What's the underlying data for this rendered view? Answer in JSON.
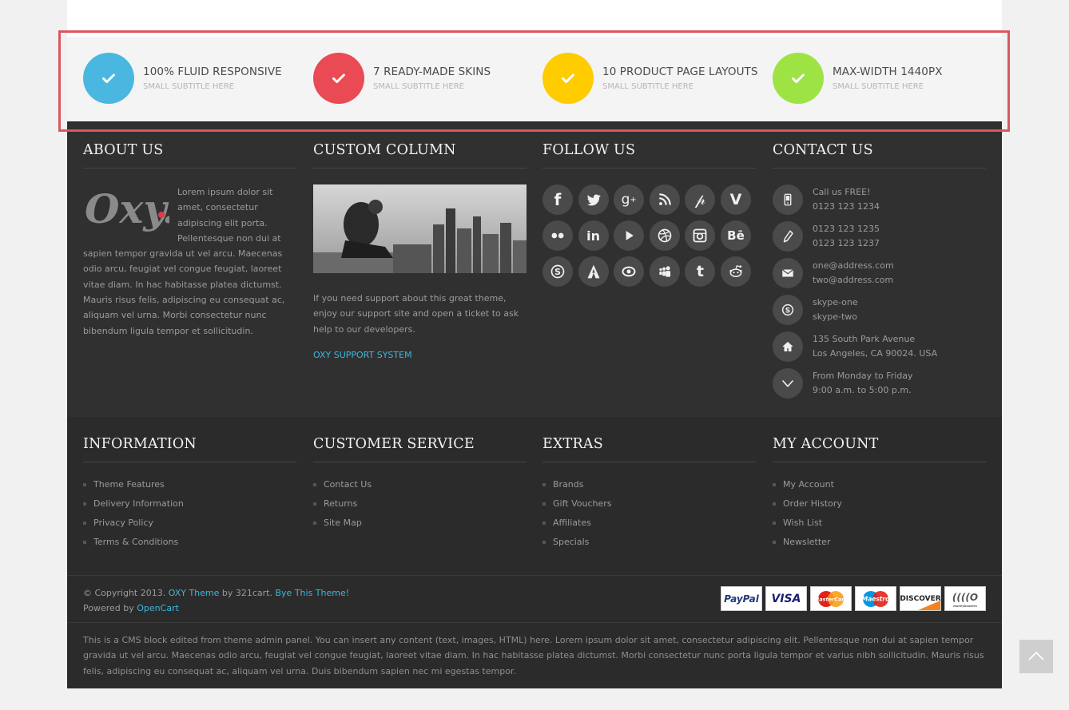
{
  "features": [
    {
      "title": "100% FLUID RESPONSIVE",
      "subtitle": "SMALL SUBTITLE HERE",
      "color": "#4ab7e0"
    },
    {
      "title": "7 READY-MADE SKINS",
      "subtitle": "SMALL SUBTITLE HERE",
      "color": "#ea4a54"
    },
    {
      "title": "10 PRODUCT PAGE LAYOUTS",
      "subtitle": "SMALL SUBTITLE HERE",
      "color": "#ffcc00"
    },
    {
      "title": "MAX-WIDTH 1440PX",
      "subtitle": "SMALL SUBTITLE HERE",
      "color": "#9ee344"
    }
  ],
  "about": {
    "heading": "ABOUT US",
    "logo_text": "Oxy.",
    "text": "Lorem ipsum dolor sit amet, consectetur adipiscing elit porta. Pellentesque non dui at sapien tempor gravida ut vel arcu. Maecenas odio arcu, feugiat vel congue feugiat, laoreet vitae diam. In hac habitasse platea dictumst. Mauris risus felis, adipiscing eu consequat ac, aliquam vel urna. Morbi consectetur nunc bibendum ligula tempor et sollicitudin."
  },
  "custom": {
    "heading": "CUSTOM COLUMN",
    "text": "If you need support about this great theme, enjoy our support site and open a ticket to ask help to our developers.",
    "link": "OXY SUPPORT SYSTEM"
  },
  "follow": {
    "heading": "FOLLOW US",
    "icons": [
      {
        "name": "facebook-icon",
        "glyph": "f"
      },
      {
        "name": "twitter-icon",
        "glyph": "🐦"
      },
      {
        "name": "google-plus-icon",
        "glyph": "g+"
      },
      {
        "name": "rss-icon",
        "glyph": "rss"
      },
      {
        "name": "pinterest-icon",
        "glyph": "P"
      },
      {
        "name": "vimeo-icon",
        "glyph": "V"
      },
      {
        "name": "flickr-icon",
        "glyph": "●●"
      },
      {
        "name": "linkedin-icon",
        "glyph": "in"
      },
      {
        "name": "youtube-icon",
        "glyph": "▶"
      },
      {
        "name": "dribbble-icon",
        "glyph": "◎"
      },
      {
        "name": "instagram-icon",
        "glyph": "▣"
      },
      {
        "name": "behance-icon",
        "glyph": "Bē"
      },
      {
        "name": "skype-icon",
        "glyph": "S"
      },
      {
        "name": "foursquare-icon",
        "glyph": "A"
      },
      {
        "name": "eye-icon",
        "glyph": "◉"
      },
      {
        "name": "myspace-icon",
        "glyph": "♟"
      },
      {
        "name": "tumblr-icon",
        "glyph": "t"
      },
      {
        "name": "reddit-icon",
        "glyph": "☻"
      }
    ]
  },
  "contact": {
    "heading": "CONTACT US",
    "rows": [
      {
        "icon": "mobile-phone-icon",
        "line1": "Call us FREE!",
        "line2": "0123 123 1234"
      },
      {
        "icon": "phone-icon",
        "line1": "0123 123 1235",
        "line2": "0123 123 1237"
      },
      {
        "icon": "envelope-icon",
        "line1": "one@address.com",
        "line2": "two@address.com"
      },
      {
        "icon": "skype-icon",
        "line1": "skype-one",
        "line2": "skype-two"
      },
      {
        "icon": "home-icon",
        "line1": "135 South Park Avenue",
        "line2": "Los Angeles, CA 90024. USA"
      },
      {
        "icon": "clock-chevron-icon",
        "line1": "From Monday to Friday",
        "line2": "9:00 a.m. to 5:00 p.m."
      }
    ]
  },
  "information": {
    "heading": "INFORMATION",
    "items": [
      "Theme Features",
      "Delivery Information",
      "Privacy Policy",
      "Terms & Conditions"
    ]
  },
  "customer_service": {
    "heading": "CUSTOMER SERVICE",
    "items": [
      "Contact Us",
      "Returns",
      "Site Map"
    ]
  },
  "extras": {
    "heading": "EXTRAS",
    "items": [
      "Brands",
      "Gift Vouchers",
      "Affiliates",
      "Specials"
    ]
  },
  "my_account": {
    "heading": "MY ACCOUNT",
    "items": [
      "My Account",
      "Order History",
      "Wish List",
      "Newsletter"
    ]
  },
  "copyright": {
    "prefix": "© Copyright 2013.",
    "theme_link": "OXY Theme",
    "by": "by 321cart.",
    "buy_link": "Bye This Theme!",
    "powered": "Powered by",
    "opencart_link": "OpenCart"
  },
  "payments": [
    "PayPal",
    "VISA",
    "MasterCard",
    "Maestro",
    "DISCOVER",
    "moneybookers"
  ],
  "cms_text": "This is a CMS block edited from theme admin panel. You can insert any content (text, images, HTML) here. Lorem ipsum dolor sit amet, consectetur adipiscing elit. Pellentesque non dui at sapien tempor gravida ut vel arcu. Maecenas odio arcu, feugiat vel congue feugiat, laoreet vitae diam. In hac habitasse platea dictumst. Morbi consectetur nunc porta ligula tempor et varius nibh sollicitudin. Mauris risus felis, adipiscing eu consequat ac, aliquam vel urna. Duis bibendum sapien nec mi egestas tempor.",
  "colors": {
    "accent_link": "#3db7dd",
    "highlight_border": "#d9575e"
  }
}
